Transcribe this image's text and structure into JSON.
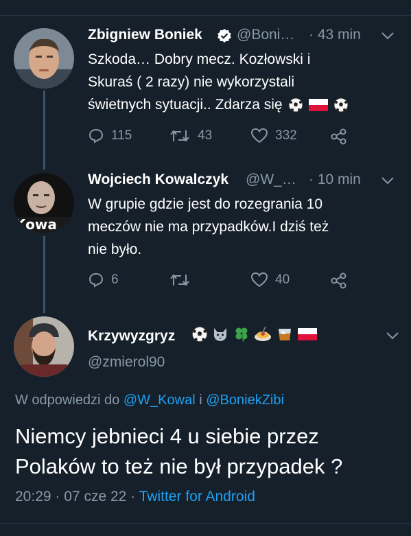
{
  "tweets": [
    {
      "name": "Zbigniew Boniek",
      "handle": "@Boni…",
      "time": "· 43 min",
      "lines": [
        "Szkoda… Dobry mecz. Kozłowski i",
        "Skuraś ( 2 razy) nie wykorzystali",
        "świetnych sytuacji.. Zdarza się"
      ],
      "replies": "115",
      "retweets": "43",
      "likes": "332"
    },
    {
      "name": "Wojciech Kowalczyk",
      "handle": "@W_…",
      "time": "· 10 min",
      "lines": [
        "W grupie gdzie jest do rozegrania 10",
        "meczów nie ma przypadków.I dziś też",
        "nie było."
      ],
      "avatar_text": "Kowa",
      "replies": "6",
      "retweets": "",
      "likes": "40"
    }
  ],
  "main": {
    "name": "Krzywyzgryz",
    "handle": "@zmierol90",
    "reply_prefix": "W odpowiedzi do",
    "reply_user1": "@W_Kowal",
    "reply_and": "i",
    "reply_user2": "@BoniekZibi",
    "text_line1": "Niemcy jebnieci 4 u siebie przez",
    "text_line2": "Polaków to też nie był przypadek ?",
    "time": "20:29",
    "date": "07 cze 22",
    "source": "Twitter for Android"
  },
  "colors": {
    "background": "#15202b",
    "secondary_text": "#8899a6",
    "link": "#1da1f2",
    "verified": "#ffffff"
  }
}
